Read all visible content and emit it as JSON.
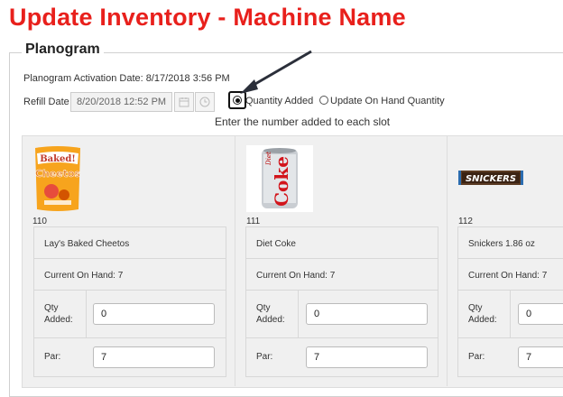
{
  "page": {
    "title": "Update Inventory - Machine Name"
  },
  "planogram": {
    "legend": "Planogram",
    "activation_text": "Planogram Activation Date: 8/17/2018 3:56 PM",
    "refill_label": "Refill Date",
    "refill_value": "8/20/2018 12:52 PM",
    "mode_options": [
      {
        "label": "Quantity Added",
        "selected": true
      },
      {
        "label": "Update On Hand Quantity",
        "selected": false
      }
    ],
    "instruction": "Enter the number added to each slot"
  },
  "slots": [
    {
      "number": "110",
      "image_icon": "cheetos-bag",
      "product": "Lay's Baked Cheetos",
      "current_on_hand": "Current On Hand: 7",
      "qty_label": "Qty\nAdded:",
      "qty_value": "0",
      "par_label": "Par:",
      "par_value": "7"
    },
    {
      "number": "111",
      "image_icon": "diet-coke-can",
      "product": "Diet Coke",
      "current_on_hand": "Current On Hand: 7",
      "qty_label": "Qty\nAdded:",
      "qty_value": "0",
      "par_label": "Par:",
      "par_value": "7"
    },
    {
      "number": "112",
      "image_icon": "snickers-bar",
      "product": "Snickers 1.86 oz",
      "current_on_hand": "Current On Hand: 7",
      "qty_label": "Qty\nAdded:",
      "qty_value": "0",
      "par_label": "Par:",
      "par_value": "7"
    }
  ],
  "colors": {
    "title": "#e8201c",
    "panel": "#f0f0f0",
    "border": "#d8d8d8"
  }
}
